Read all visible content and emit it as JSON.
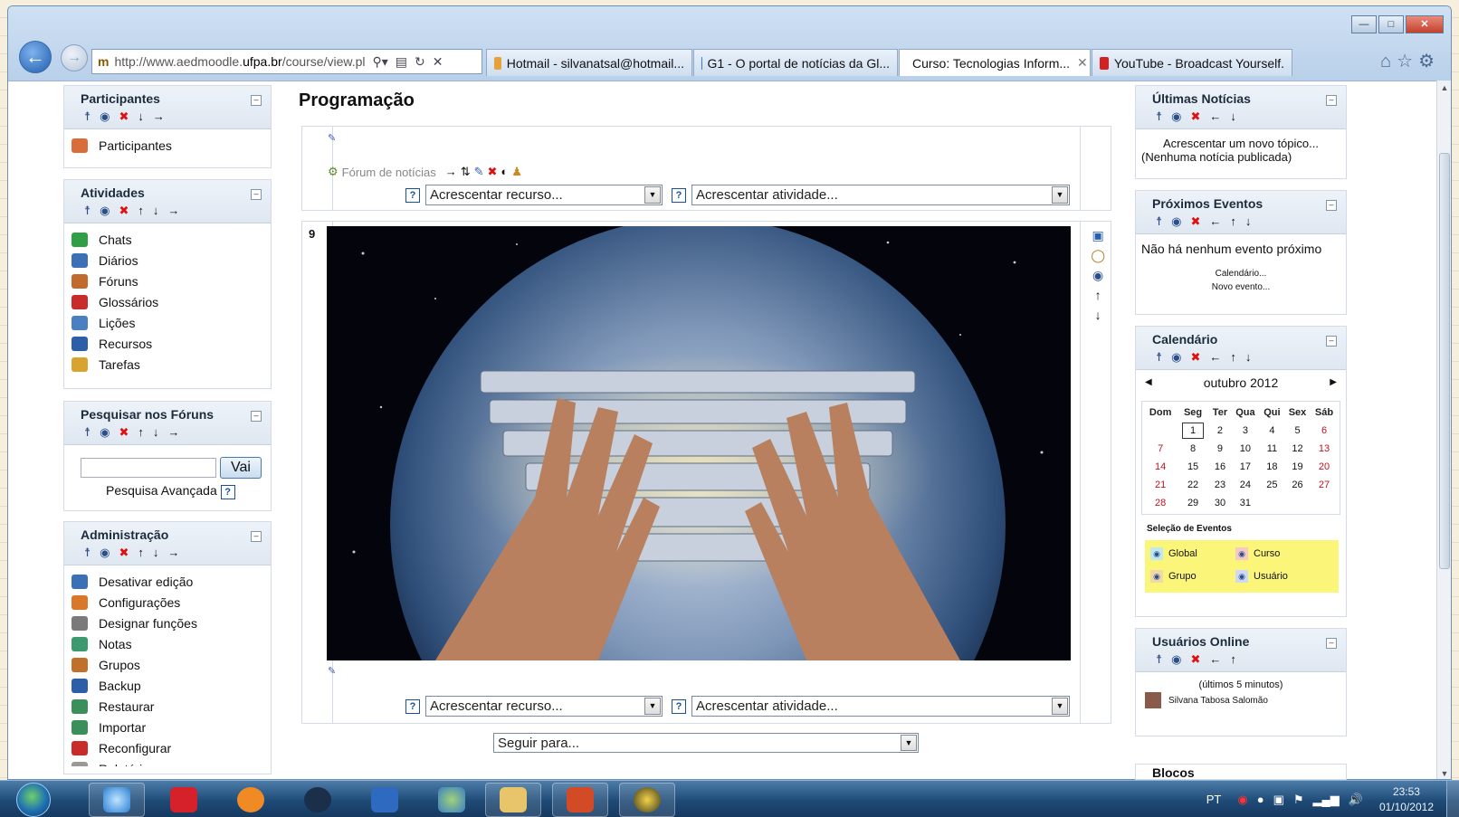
{
  "browser": {
    "url_prefix": "http://www.aedmoodle.",
    "url_domain": "ufpa.br",
    "url_suffix": "/course/view.pl",
    "tabs": [
      {
        "label": "Hotmail - silvanatsal@hotmail...",
        "color": "#e8a13a"
      },
      {
        "label": "G1 - O portal de notícias da Gl...",
        "color": "#3b7bc8"
      },
      {
        "label": "Curso: Tecnologias Inform...",
        "color": "#c99a2a",
        "active": true
      },
      {
        "label": "YouTube - Broadcast Yourself.",
        "color": "#d42020"
      }
    ]
  },
  "left": {
    "participantes": {
      "title": "Participantes",
      "items": [
        "Participantes"
      ]
    },
    "atividades": {
      "title": "Atividades",
      "items": [
        "Chats",
        "Diários",
        "Fóruns",
        "Glossários",
        "Lições",
        "Recursos",
        "Tarefas"
      ]
    },
    "pesquisar": {
      "title": "Pesquisar nos Fóruns",
      "button": "Vai",
      "advanced": "Pesquisa Avançada"
    },
    "administracao": {
      "title": "Administração",
      "items": [
        "Desativar edição",
        "Configurações",
        "Designar funções",
        "Notas",
        "Grupos",
        "Backup",
        "Restaurar",
        "Importar",
        "Reconfigurar",
        "Relatórios"
      ]
    }
  },
  "center": {
    "title": "Programação",
    "forum_link": "Fórum de notícias",
    "add_resource": "Acrescentar recurso...",
    "add_activity": "Acrescentar atividade...",
    "section_number": "9",
    "jump_to": "Seguir para..."
  },
  "right": {
    "noticias": {
      "title": "Últimas Notícias",
      "add": "Acrescentar um novo tópico...",
      "none": "(Nenhuma notícia publicada)"
    },
    "eventos": {
      "title": "Próximos Eventos",
      "none": "Não há nenhum evento próximo",
      "calendar": "Calendário...",
      "new_event": "Novo evento..."
    },
    "calendario": {
      "title": "Calendário",
      "month": "outubro 2012",
      "days": [
        "Dom",
        "Seg",
        "Ter",
        "Qua",
        "Qui",
        "Sex",
        "Sáb"
      ],
      "weeks": [
        [
          "",
          "1",
          "2",
          "3",
          "4",
          "5",
          "6"
        ],
        [
          "7",
          "8",
          "9",
          "10",
          "11",
          "12",
          "13"
        ],
        [
          "14",
          "15",
          "16",
          "17",
          "18",
          "19",
          "20"
        ],
        [
          "21",
          "22",
          "23",
          "24",
          "25",
          "26",
          "27"
        ],
        [
          "28",
          "29",
          "30",
          "31",
          "",
          "",
          ""
        ]
      ],
      "events_label": "Seleção de Eventos",
      "legend": [
        "Global",
        "Curso",
        "Grupo",
        "Usuário"
      ]
    },
    "online": {
      "title": "Usuários Online",
      "period": "(últimos 5 minutos)",
      "user": "Silvana Tabosa Salomão"
    },
    "blocos": {
      "title": "Blocos"
    }
  },
  "taskbar": {
    "lang": "PT",
    "time": "23:53",
    "date": "01/10/2012"
  }
}
